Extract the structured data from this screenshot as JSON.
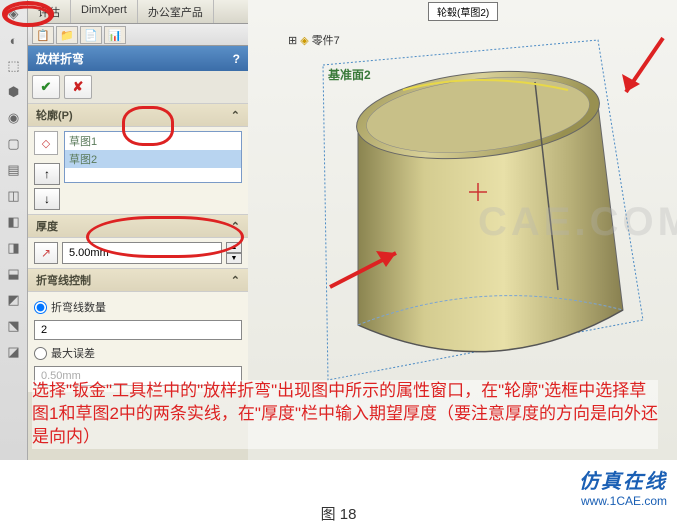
{
  "tabs": {
    "eval": "评估",
    "dimxpert": "DimXpert",
    "office": "办公室产品"
  },
  "model_tag": "轮毂(草图2)",
  "part_name": "零件7",
  "face_label": "基准面2",
  "panel": {
    "title": "放样折弯",
    "help": "?",
    "profiles": {
      "header": "轮廓(P)",
      "items": [
        "草图1",
        "草图2"
      ]
    },
    "thickness": {
      "header": "厚度",
      "value": "5.00mm"
    },
    "bend_control": {
      "header": "折弯线控制",
      "opt1": "折弯线数量",
      "count": "2",
      "opt2": "最大误差",
      "tol": "0.50mm"
    }
  },
  "instruction": "选择\"钣金\"工具栏中的\"放样折弯\"出现图中所示的属性窗口，在\"轮廓\"选框中选择草图1和草图2中的两条实线，在\"厚度\"栏中输入期望厚度（要注意厚度的方向是向外还是向内）",
  "caption": "图 18",
  "brand": {
    "cn": "仿真在线",
    "url": "www.1CAE.com"
  },
  "watermark": "CAE.COM"
}
